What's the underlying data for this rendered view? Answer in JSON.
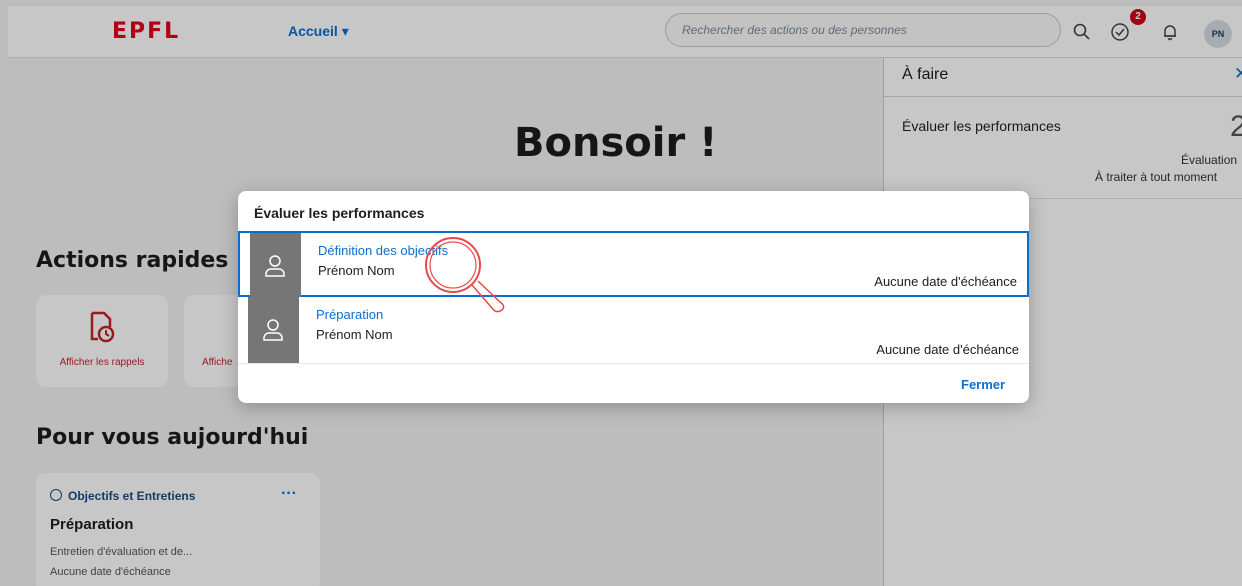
{
  "header": {
    "logo": "EPFL",
    "home_menu": "Accueil ▾",
    "search_placeholder": "Rechercher des actions ou des personnes",
    "todo_badge_count": "2",
    "user_initials": "PN",
    "accent_color": "#0a6ed1",
    "brand_color": "#e2001a"
  },
  "main": {
    "greeting": "Bonsoir !",
    "quick_actions_title": "Actions rapides",
    "quick_actions": [
      {
        "label": "Afficher les rappels",
        "icon": "reminder-icon"
      },
      {
        "label": "Affiche",
        "icon": "document-icon"
      }
    ],
    "today_title": "Pour vous aujourd'hui",
    "todo_card": {
      "category": "Objectifs et Entretiens",
      "title": "Préparation",
      "subtitle": "Entretien d'évaluation et de...",
      "due": "Aucune date d'échéance"
    }
  },
  "side_panel": {
    "title": "À faire",
    "item_label": "Évaluer les performances",
    "item_count": "2",
    "item_type": "Évaluation",
    "item_when": "À traiter à tout moment"
  },
  "dialog": {
    "title": "Évaluer les performances",
    "rows": [
      {
        "link": "Définition des objectifs",
        "name": "Prénom Nom",
        "due": "Aucune date d'échéance"
      },
      {
        "link": "Préparation",
        "name": "Prénom Nom",
        "due": "Aucune date d'échéance"
      }
    ],
    "close_label": "Fermer"
  }
}
